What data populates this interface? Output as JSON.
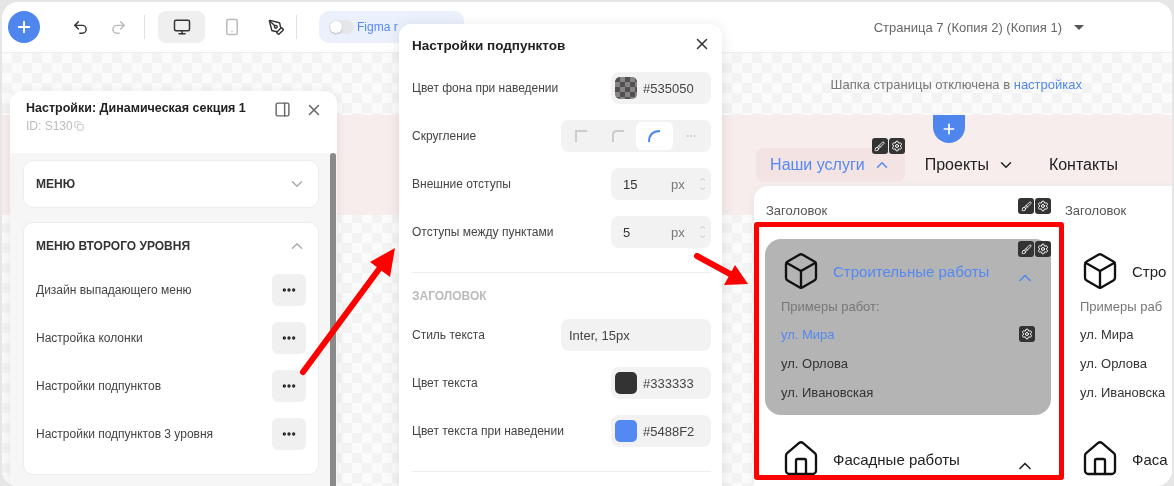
{
  "toolbar": {
    "view_modes": [
      {
        "kind": "desktop",
        "selected": true
      },
      {
        "kind": "mobile",
        "selected": false
      }
    ],
    "figma_mode": {
      "label": "Figma r",
      "on": false
    },
    "page_selector": {
      "value": "Страница 7 (Копия 2) (Копия 1)"
    }
  },
  "header_notice": {
    "text": "Шапка страницы отключена в",
    "link": "настройках"
  },
  "nav": [
    {
      "label": "Наши услуги",
      "kind": "dropdown",
      "selected": true,
      "expanded": true
    },
    {
      "label": "Проекты",
      "kind": "dropdown",
      "selected": false,
      "expanded": false
    },
    {
      "label": "Контакты",
      "kind": "link",
      "selected": false
    }
  ],
  "dropdown": {
    "columns": [
      {
        "heading": "Заголовок",
        "items": [
          {
            "kind": "cube",
            "title": "Строительные работы",
            "hovered": true,
            "expanded": true,
            "subtitle": "Примеры работ:",
            "links": [
              {
                "label": "ул. Мира",
                "hovered": true
              },
              {
                "label": "ул. Орлова",
                "hovered": false
              },
              {
                "label": "ул. Ивановская",
                "hovered": false
              }
            ]
          },
          {
            "kind": "house",
            "title": "Фасадные работы",
            "hovered": false,
            "expanded": true
          }
        ]
      },
      {
        "heading": "Заголовок",
        "items": [
          {
            "kind": "cube",
            "title": "Стро",
            "hovered": false,
            "subtitle": "Примеры раб",
            "links": [
              {
                "label": "ул. Мира",
                "hovered": false
              },
              {
                "label": "ул. Орлова",
                "hovered": false
              },
              {
                "label": "ул. Ивановска",
                "hovered": false
              }
            ]
          },
          {
            "kind": "house",
            "title": "Фаса",
            "hovered": false
          }
        ]
      }
    ]
  },
  "settings_panel": {
    "title": "Настройки: Динамическая секция 1",
    "id": "ID: S130",
    "sections": [
      {
        "title": "МЕНЮ",
        "expanded": false
      },
      {
        "title": "МЕНЮ ВТОРОГО УРОВНЯ",
        "expanded": true,
        "rows": [
          "Дизайн выпадающего меню",
          "Настройка колонки",
          "Настройки подпунктов",
          "Настройки подпунктов 3 уровня"
        ]
      }
    ]
  },
  "subitems_popup": {
    "title": "Настройки подпунктов",
    "rows": [
      {
        "kind": "color",
        "label": "Цвет фона при наведении",
        "value": "#535050",
        "color": "#535050",
        "transparent": true
      },
      {
        "kind": "radius",
        "label": "Скругление",
        "options": [
          {
            "kind": "none",
            "selected": false
          },
          {
            "kind": "small",
            "selected": false
          },
          {
            "kind": "large",
            "selected": true
          },
          {
            "kind": "more",
            "selected": false
          }
        ]
      },
      {
        "kind": "number",
        "label": "Внешние отступы",
        "value": "15",
        "unit": "px"
      },
      {
        "kind": "number",
        "label": "Отступы между пунктами",
        "value": "5",
        "unit": "px"
      },
      {
        "kind": "divider"
      },
      {
        "kind": "heading",
        "label": "ЗАГОЛОВОК"
      },
      {
        "kind": "text",
        "label": "Стиль текста",
        "value": "Inter, 15px"
      },
      {
        "kind": "color",
        "label": "Цвет текста",
        "value": "#333333",
        "color": "#333333",
        "transparent": false
      },
      {
        "kind": "color",
        "label": "Цвет текста при наведении",
        "value": "#5488F2",
        "color": "#5488F2",
        "transparent": false
      },
      {
        "kind": "divider"
      }
    ]
  }
}
